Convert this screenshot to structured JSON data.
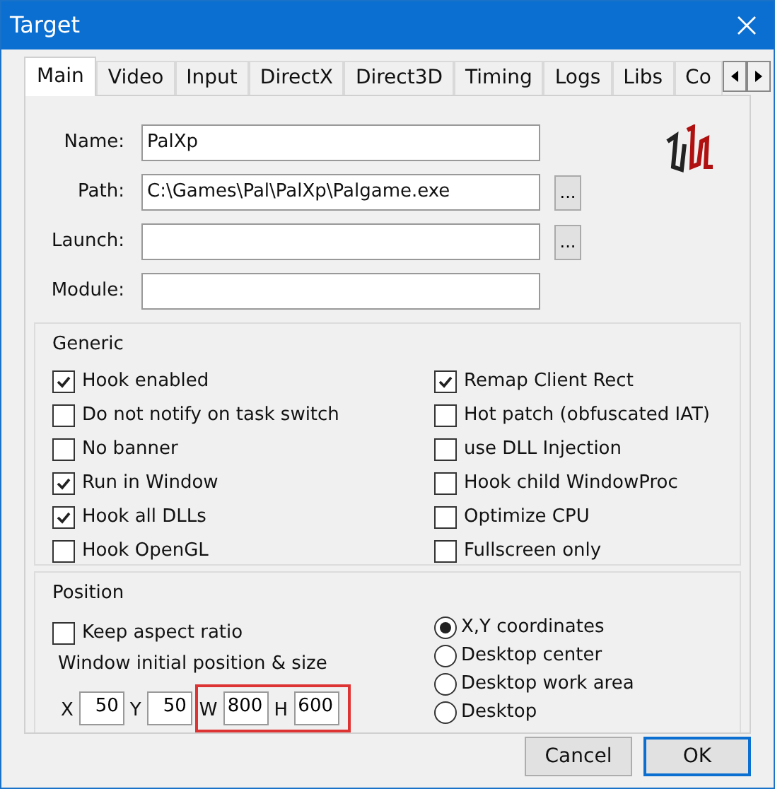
{
  "window": {
    "title": "Target"
  },
  "tabs": [
    {
      "label": "Main",
      "selected": true
    },
    {
      "label": "Video",
      "selected": false
    },
    {
      "label": "Input",
      "selected": false
    },
    {
      "label": "DirectX",
      "selected": false
    },
    {
      "label": "Direct3D",
      "selected": false
    },
    {
      "label": "Timing",
      "selected": false
    },
    {
      "label": "Logs",
      "selected": false
    },
    {
      "label": "Libs",
      "selected": false
    },
    {
      "label": "Co",
      "selected": false
    }
  ],
  "fields": [
    {
      "label": "Name:",
      "value": "PalXp",
      "browse": false
    },
    {
      "label": "Path:",
      "value": "C:\\Games\\Pal\\PalXp\\Palgame.exe",
      "browse": true,
      "browse_label": "..."
    },
    {
      "label": "Launch:",
      "browse": true,
      "browse_label": "..."
    },
    {
      "label": "Module:",
      "browse": false
    }
  ],
  "generic": {
    "title": "Generic",
    "left": [
      {
        "label": "Hook enabled",
        "checked": true
      },
      {
        "label": "Do not notify on task switch",
        "checked": false
      },
      {
        "label": "No banner",
        "checked": false
      },
      {
        "label": "Run in Window",
        "checked": true
      },
      {
        "label": "Hook all DLLs",
        "checked": true
      },
      {
        "label": "Hook OpenGL",
        "checked": false
      }
    ],
    "right": [
      {
        "label": "Remap Client Rect",
        "checked": true
      },
      {
        "label": "Hot patch (obfuscated IAT)",
        "checked": false
      },
      {
        "label": "use DLL Injection",
        "checked": false
      },
      {
        "label": "Hook child WindowProc",
        "checked": false
      },
      {
        "label": "Optimize CPU",
        "checked": false
      },
      {
        "label": "Fullscreen only",
        "checked": false
      }
    ]
  },
  "position": {
    "title": "Position",
    "keep_aspect": {
      "label": "Keep aspect ratio",
      "checked": false
    },
    "caption": "Window initial position & size",
    "coords": [
      {
        "label": "X",
        "value": "50",
        "highlighted": false
      },
      {
        "label": "Y",
        "value": "50",
        "highlighted": false
      },
      {
        "label": "W",
        "value": "800",
        "highlighted": true
      },
      {
        "label": "H",
        "value": "600",
        "highlighted": true
      }
    ],
    "modes": [
      {
        "label": "X,Y coordinates",
        "selected": true
      },
      {
        "label": "Desktop center",
        "selected": false
      },
      {
        "label": "Desktop work area",
        "selected": false
      },
      {
        "label": "Desktop",
        "selected": false
      }
    ]
  },
  "buttons": [
    {
      "label": "Cancel",
      "default": false
    },
    {
      "label": "OK",
      "default": true
    }
  ]
}
